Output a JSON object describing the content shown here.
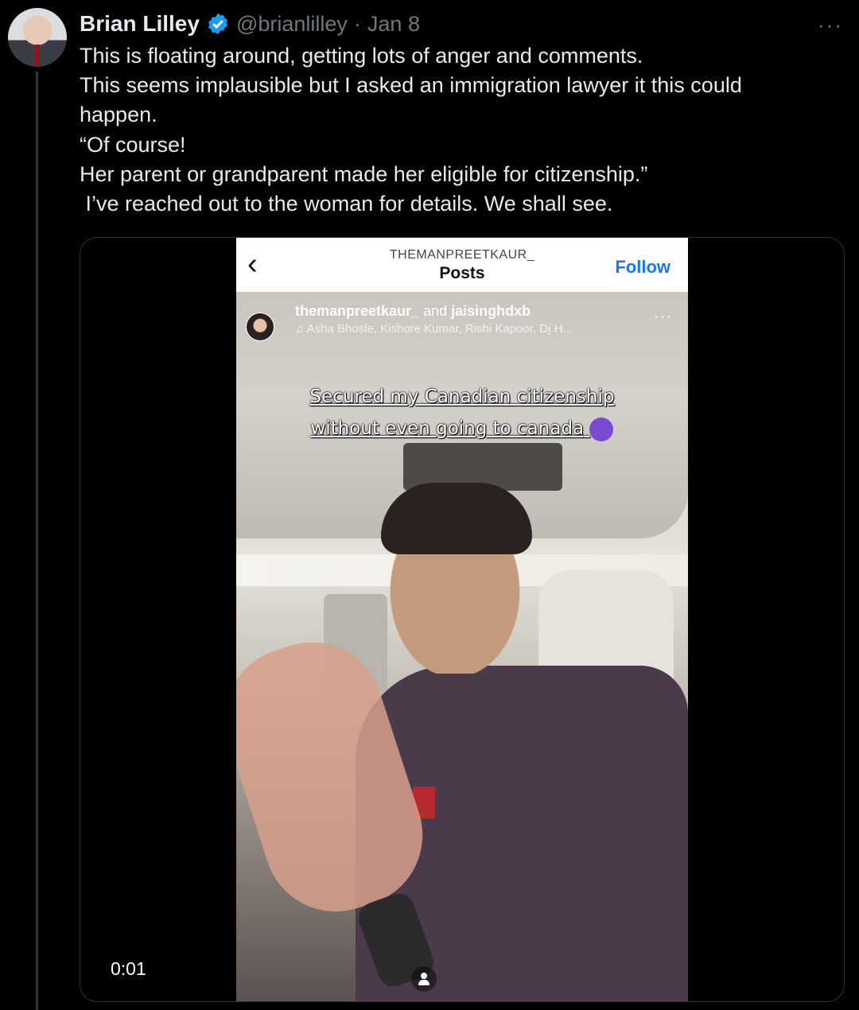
{
  "tweet": {
    "display_name": "Brian Lilley",
    "handle": "@brianlilley",
    "separator": "·",
    "date": "Jan 8",
    "more_label": "···",
    "lines": [
      "This is floating around, getting lots of anger and comments.",
      "This seems implausible but I asked an immigration lawyer it this could",
      "happen.",
      "“Of course!",
      "Her parent or grandparent made her eligible for citizenship.”",
      " I’ve reached out to the woman for details. We shall see."
    ],
    "verified_color": "#1d9bf0"
  },
  "video": {
    "timestamp": "0:01",
    "instagram": {
      "username_header": "THEMANPREETKAUR_",
      "page_title": "Posts",
      "follow_label": "Follow",
      "back_icon": "‹",
      "owner_a": "themanpreetkaur_",
      "owner_join": " and ",
      "owner_b": "jaisinghdxb",
      "music": "♫ Asha Bhosle,  Kishore Kumar,  Rishi Kapoor,  Dj H...",
      "more_label": "···",
      "caption_line1": "Secured my Canadian citizenship",
      "caption_line2": "without even going to canada",
      "follow_color": "#1877f2"
    }
  }
}
